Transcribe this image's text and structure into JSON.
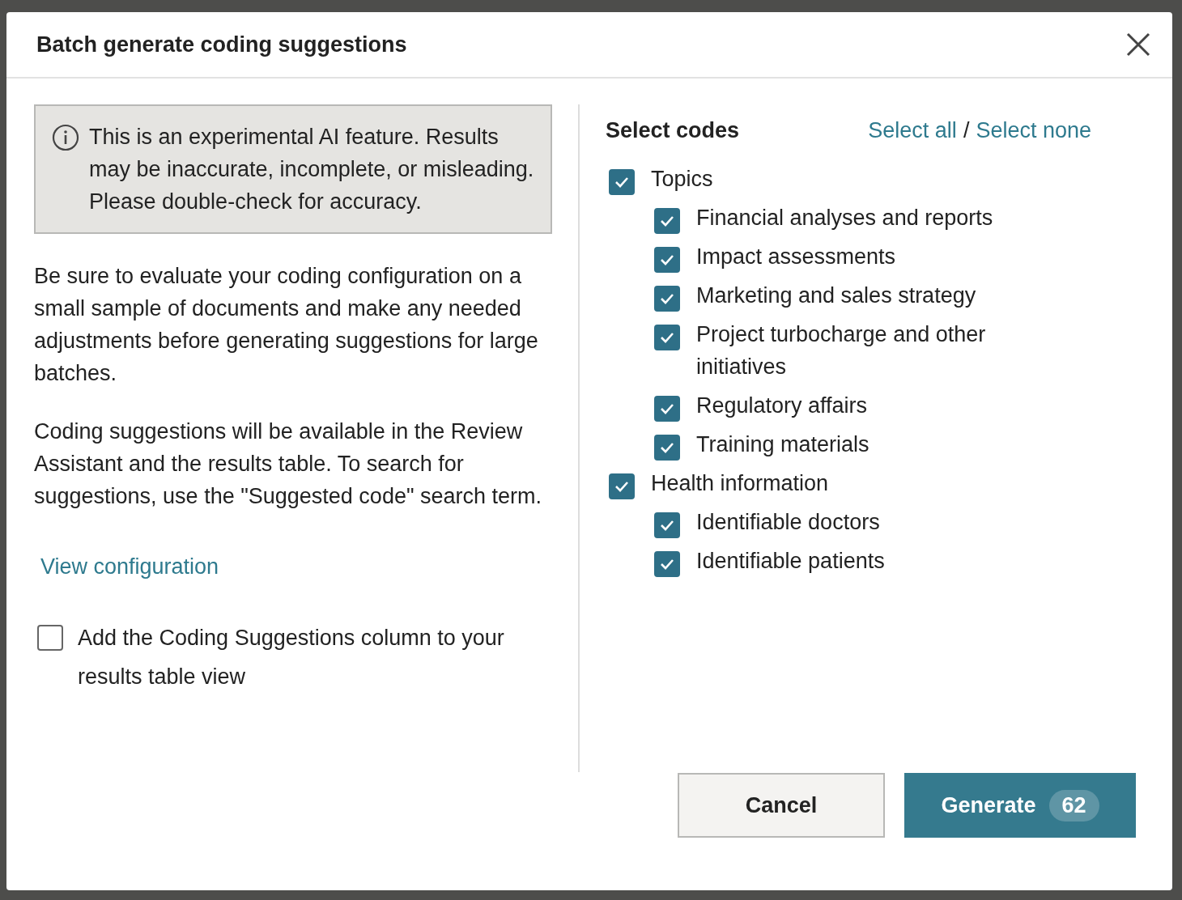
{
  "dialog": {
    "title": "Batch generate coding suggestions",
    "notice": "This is an experimental AI feature. Results may be inaccurate, incomplete, or misleading. Please double-check for accuracy.",
    "paragraphs": [
      "Be sure to evaluate your coding configuration on a small sample of documents and make any needed adjustments before generating suggestions for large batches.",
      "Coding suggestions will be available in the Review Assistant and the results table. To search for suggestions, use the \"Suggested code\" search term."
    ],
    "link": "View configuration",
    "add_column": {
      "label": "Add the Coding Suggestions column to your results table view",
      "checked": false
    },
    "codes": {
      "heading": "Select codes",
      "select_all": "Select all",
      "separator": "/",
      "select_none": "Select none",
      "items": [
        {
          "label": "Topics",
          "checked": true,
          "children": [
            {
              "label": "Financial analyses and reports",
              "checked": true
            },
            {
              "label": "Impact assessments",
              "checked": true
            },
            {
              "label": "Marketing and sales strategy",
              "checked": true
            },
            {
              "label": "Project turbocharge and other initiatives",
              "checked": true
            },
            {
              "label": "Regulatory affairs",
              "checked": true
            },
            {
              "label": "Training materials",
              "checked": true
            }
          ]
        },
        {
          "label": "Health information",
          "checked": true,
          "children": [
            {
              "label": "Identifiable doctors",
              "checked": true
            },
            {
              "label": "Identifiable patients",
              "checked": true
            }
          ]
        }
      ]
    },
    "buttons": {
      "cancel": "Cancel",
      "generate": "Generate",
      "count": "62"
    }
  }
}
